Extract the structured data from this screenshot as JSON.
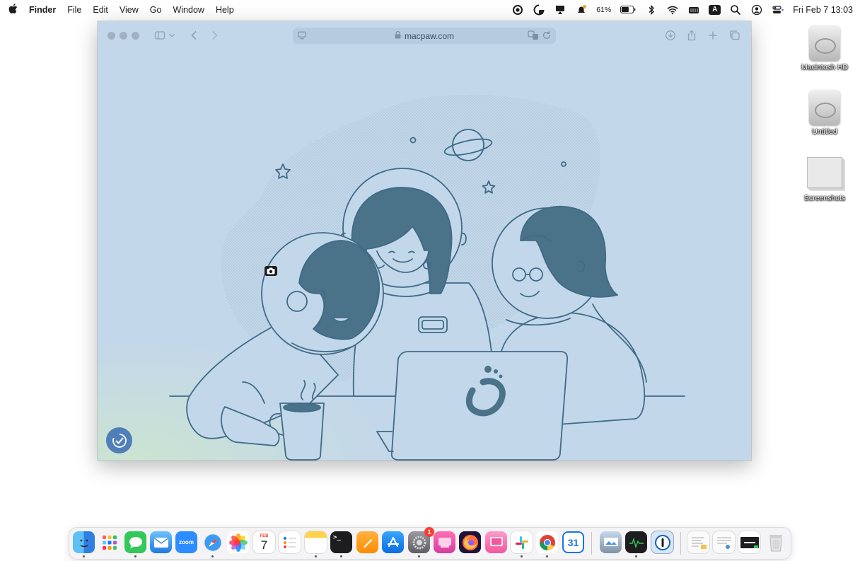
{
  "menubar": {
    "apple_icon": "apple-logo-icon",
    "items": [
      "Finder",
      "File",
      "Edit",
      "View",
      "Go",
      "Window",
      "Help"
    ],
    "battery_percent": "61%",
    "input_source": "A",
    "clock": "Fri Feb 7  13:03"
  },
  "browser": {
    "address": "macpaw.com",
    "colors": {
      "page_bg": "#c3d7ea",
      "illustration_stroke": "#3f6b86",
      "illustration_fill": "#4a7289",
      "badge": "#4e7fb9"
    }
  },
  "desktop": {
    "icons": [
      {
        "label": "Macintosh HD",
        "icon": "hard-drive-icon"
      },
      {
        "label": "Untitled",
        "icon": "hard-drive-icon"
      },
      {
        "label": "Screenshots",
        "icon": "folder-icon"
      }
    ]
  },
  "dock": {
    "apps": [
      {
        "name": "Finder",
        "icon": "finder-icon"
      },
      {
        "name": "Launchpad",
        "icon": "launchpad-icon"
      },
      {
        "name": "Messages",
        "icon": "messages-icon"
      },
      {
        "name": "Mail",
        "icon": "mail-icon"
      },
      {
        "name": "Zoom",
        "icon": "zoom-icon",
        "text": "zoom"
      },
      {
        "name": "Safari",
        "icon": "safari-icon"
      },
      {
        "name": "Photos",
        "icon": "photos-icon"
      },
      {
        "name": "Calendar",
        "icon": "calendar-icon",
        "month": "FEB",
        "day": "7"
      },
      {
        "name": "Reminders",
        "icon": "reminders-icon"
      },
      {
        "name": "Notes",
        "icon": "notes-icon"
      },
      {
        "name": "Terminal",
        "icon": "terminal-icon"
      },
      {
        "name": "Pages",
        "icon": "pages-icon"
      },
      {
        "name": "App Store",
        "icon": "app-store-icon"
      },
      {
        "name": "System Settings",
        "icon": "settings-icon",
        "badge": "1"
      },
      {
        "name": "CleanMyMac",
        "icon": "cleanmymac-icon"
      },
      {
        "name": "Firefox",
        "icon": "firefox-icon"
      },
      {
        "name": "Screen app",
        "icon": "pink-app-icon"
      },
      {
        "name": "Slack",
        "icon": "slack-icon"
      },
      {
        "name": "Chrome",
        "icon": "chrome-icon"
      },
      {
        "name": "Calendar 31",
        "icon": "calendar-31-icon",
        "text": "31"
      },
      {
        "name": "Preview",
        "icon": "preview-icon"
      },
      {
        "name": "Activity Monitor",
        "icon": "activity-monitor-icon"
      },
      {
        "name": "1Password",
        "icon": "onepassword-icon"
      },
      {
        "name": "Document",
        "icon": "document-thumb-icon"
      },
      {
        "name": "Document 2",
        "icon": "document-thumb-icon"
      },
      {
        "name": "Screen recording",
        "icon": "screen-thumb-icon"
      },
      {
        "name": "Trash",
        "icon": "trash-icon"
      }
    ]
  }
}
